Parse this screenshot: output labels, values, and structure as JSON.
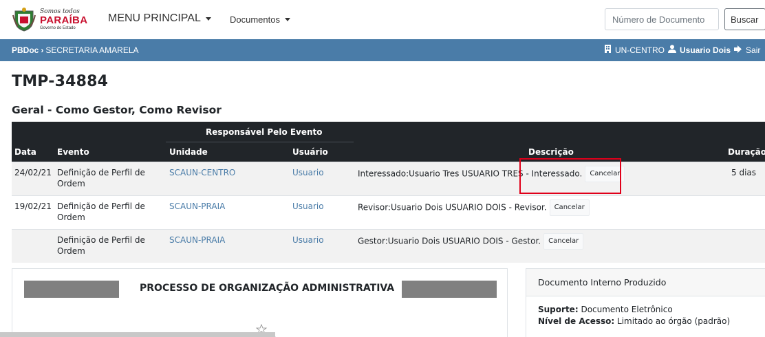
{
  "brand": {
    "script": "Somos todos",
    "name": "PARAÍBA",
    "sub": "Governo do Estado"
  },
  "nav": {
    "menu_principal": "MENU PRINCIPAL",
    "documentos": "Documentos"
  },
  "search": {
    "placeholder": "Número de Documento",
    "button": "Buscar"
  },
  "breadcrumb": {
    "root": "PBDoc",
    "separator": "›",
    "current": "SECRETARIA AMARELA"
  },
  "userbar": {
    "unit": "UN-CENTRO",
    "user": "Usuario Dois",
    "logout": "Sair"
  },
  "page": {
    "title": "TMP-34884",
    "section": "Geral - Como Gestor, Como Revisor"
  },
  "table": {
    "group_header": "Responsável Pelo Evento",
    "headers": {
      "data": "Data",
      "evento": "Evento",
      "unidade": "Unidade",
      "usuario": "Usuário",
      "descricao": "Descrição",
      "duracao": "Duração"
    },
    "rows": [
      {
        "data": "24/02/21",
        "evento_l1": "Definição de Perfil de",
        "evento_l2": "Ordem",
        "unidade": "SCAUN-CENTRO",
        "usuario": "Usuario",
        "descricao": "Interessado:Usuario Tres USUARIO TRES - Interessado.",
        "cancelar": "Cancelar",
        "duracao": "5 dias"
      },
      {
        "data": "19/02/21",
        "evento_l1": "Definição de Perfil de",
        "evento_l2": "Ordem",
        "unidade": "SCAUN-PRAIA",
        "usuario": "Usuario",
        "descricao": "Revisor:Usuario Dois USUARIO DOIS - Revisor.",
        "cancelar": "Cancelar",
        "duracao": ""
      },
      {
        "data": "",
        "evento_l1": "Definição de Perfil de",
        "evento_l2": "Ordem",
        "unidade": "SCAUN-PRAIA",
        "usuario": "Usuario",
        "descricao": "Gestor:Usuario Dois USUARIO DOIS - Gestor.",
        "cancelar": "Cancelar",
        "duracao": ""
      }
    ]
  },
  "document": {
    "heading": "PROCESSO DE ORGANIZAÇÃO ADMINISTRATIVA"
  },
  "info": {
    "header": "Documento Interno Produzido",
    "suporte_label": "Suporte:",
    "suporte_value": "Documento Eletrônico",
    "acesso_label": "Nível de Acesso:",
    "acesso_value": "Limitado ao órgão (padrão)"
  },
  "colors": {
    "accent_bar": "#4a7ca8",
    "table_header": "#212529",
    "link": "#4a7ca8",
    "highlight": "#e0001a",
    "brand_red": "#c8102e"
  }
}
